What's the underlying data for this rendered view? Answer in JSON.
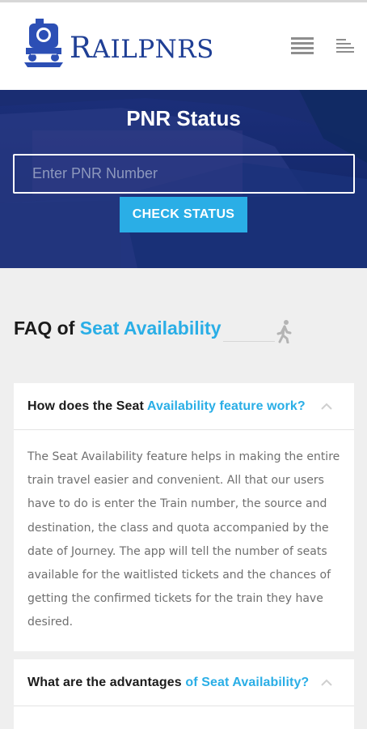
{
  "header": {
    "brand_initial": "R",
    "brand_rest": "AILPNRS"
  },
  "hero": {
    "title": "PNR Status",
    "input_placeholder": "Enter PNR Number",
    "button_label": "CHECK STATUS"
  },
  "faq": {
    "heading_prefix": "FAQ of",
    "heading_accent": "Seat Availability",
    "items": [
      {
        "question_prefix": "How does the Seat",
        "question_accent": "Availability feature work?",
        "answer": "The Seat Availability feature helps in making the entire train travel easier and convenient. All that our users have to do is enter the Train number, the source and destination, the class and quota accompanied by the date of Journey. The app will tell the number of seats available for the waitlisted tickets and the chances of getting the confirmed tickets for the train they have desired."
      },
      {
        "question_prefix": "What are the advantages",
        "question_accent": "of Seat Availability?"
      }
    ]
  },
  "colors": {
    "brand": "#1f3f95",
    "accent": "#2aaee6",
    "hero_bg": "#15296d"
  },
  "icons": {
    "logo": "train-logo-icon",
    "menu_grid": "menu-grid-icon",
    "menu_lines": "menu-lines-icon",
    "walk": "walking-person-icon",
    "chevron": "chevron-up-icon"
  }
}
